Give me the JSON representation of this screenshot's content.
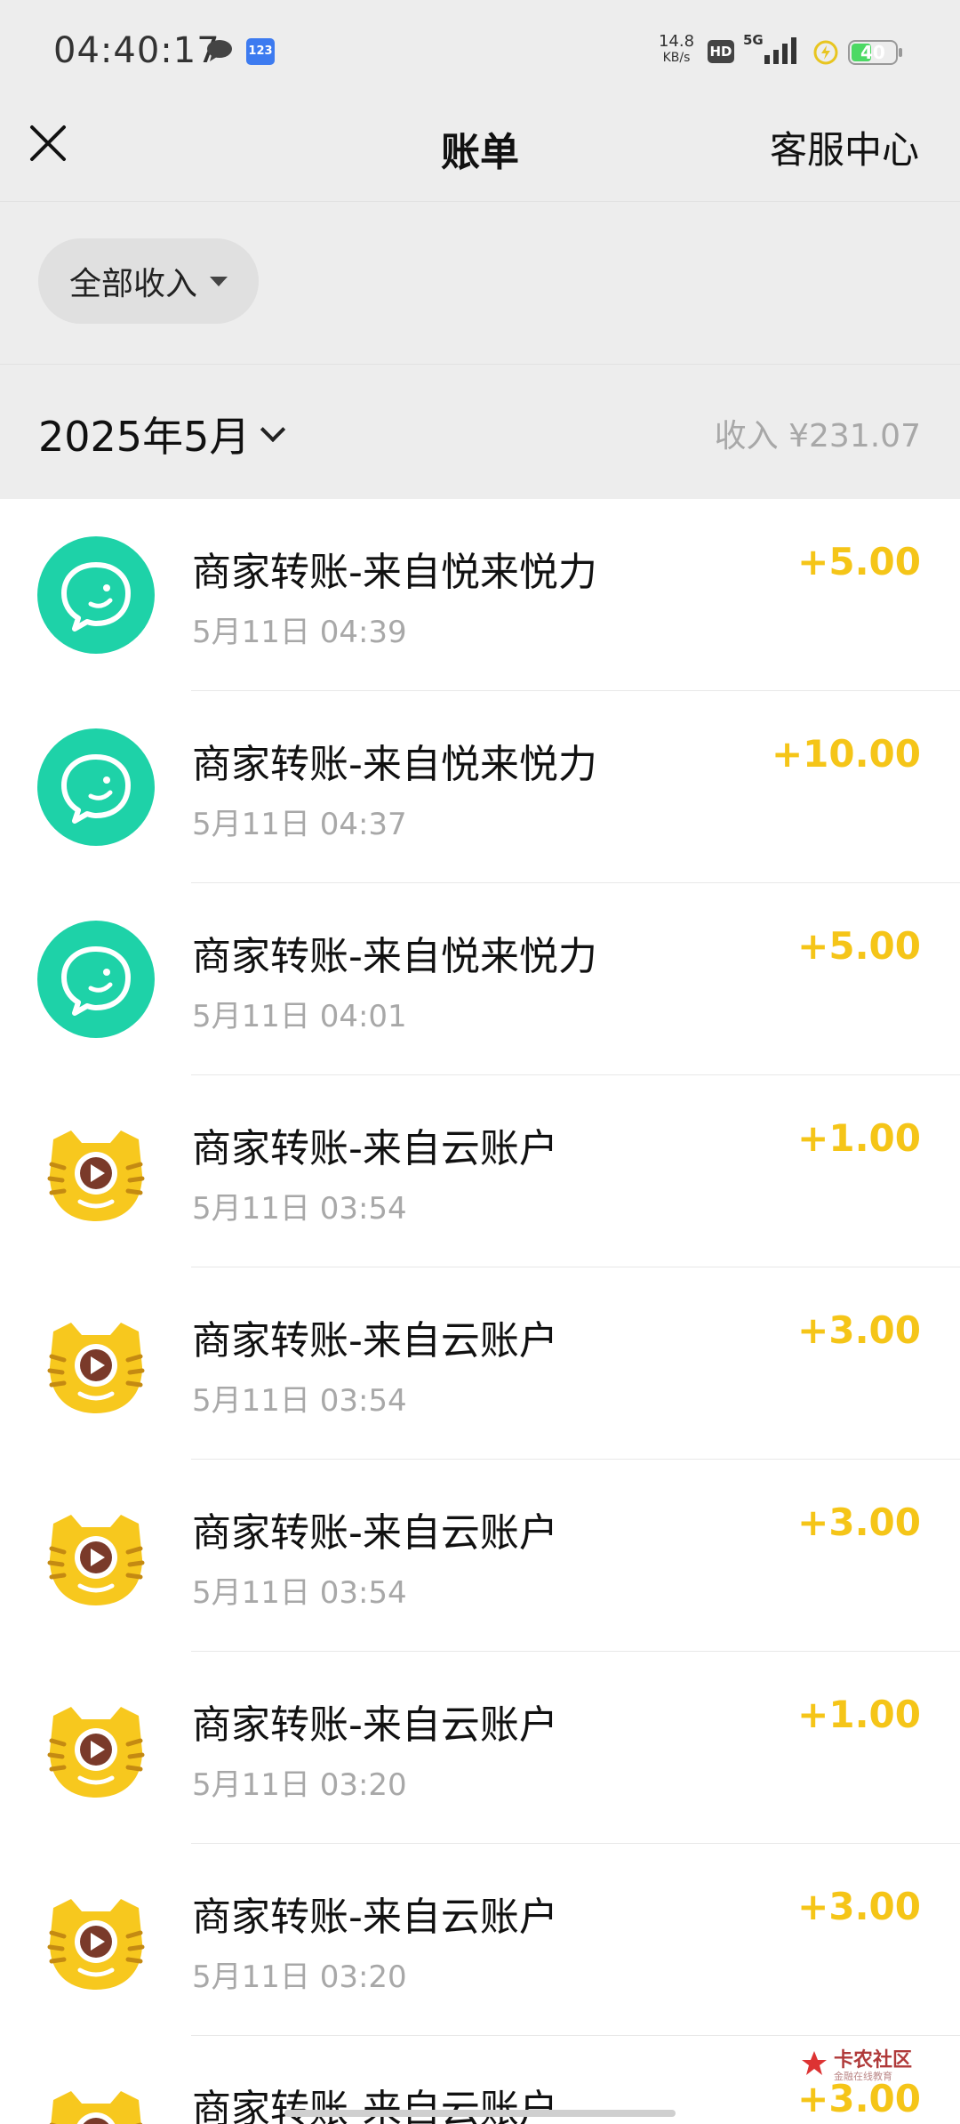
{
  "status_bar": {
    "time": "04:40:17",
    "network_speed_value": "14.8",
    "network_speed_unit": "KB/s",
    "hd_label": "HD",
    "network_type": "5G",
    "battery_level": "40",
    "app_badge": "123"
  },
  "header": {
    "title": "账单",
    "right_action": "客服中心"
  },
  "filter": {
    "label": "全部收入"
  },
  "month": {
    "label": "2025年5月",
    "income_summary": "收入 ¥231.07"
  },
  "colors": {
    "amount": "#f5c518",
    "wechat_green": "#1ed2a8",
    "tiger_yellow": "#f7c81e"
  },
  "transactions": [
    {
      "title": "商家转账-来自悦来悦力",
      "time": "5月11日 04:39",
      "amount": "+5.00",
      "icon": "chat-bubble-icon"
    },
    {
      "title": "商家转账-来自悦来悦力",
      "time": "5月11日 04:37",
      "amount": "+10.00",
      "icon": "chat-bubble-icon"
    },
    {
      "title": "商家转账-来自悦来悦力",
      "time": "5月11日 04:01",
      "amount": "+5.00",
      "icon": "chat-bubble-icon"
    },
    {
      "title": "商家转账-来自云账户",
      "time": "5月11日 03:54",
      "amount": "+1.00",
      "icon": "tiger-mascot-icon"
    },
    {
      "title": "商家转账-来自云账户",
      "time": "5月11日 03:54",
      "amount": "+3.00",
      "icon": "tiger-mascot-icon"
    },
    {
      "title": "商家转账-来自云账户",
      "time": "5月11日 03:54",
      "amount": "+3.00",
      "icon": "tiger-mascot-icon"
    },
    {
      "title": "商家转账-来自云账户",
      "time": "5月11日 03:20",
      "amount": "+1.00",
      "icon": "tiger-mascot-icon"
    },
    {
      "title": "商家转账-来自云账户",
      "time": "5月11日 03:20",
      "amount": "+3.00",
      "icon": "tiger-mascot-icon"
    },
    {
      "title": "商家转账-来自云账户",
      "time": "",
      "amount": "+3.00",
      "icon": "tiger-mascot-icon"
    }
  ],
  "watermark": {
    "name": "卡农社区",
    "tagline": "金融在线教育"
  }
}
